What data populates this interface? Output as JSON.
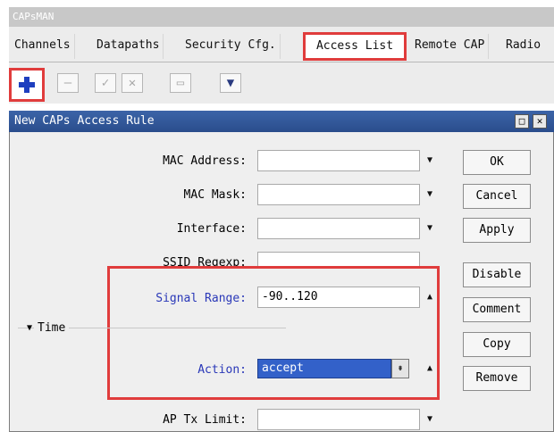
{
  "outer_window": {
    "title": "CAPsMAN"
  },
  "tabs": [
    "Channels",
    "Datapaths",
    "Security Cfg.",
    "Access List",
    "Remote CAP",
    "Radio"
  ],
  "toolbar": {
    "add": "+",
    "remove": "—",
    "enable": "✓",
    "disable": "✕",
    "comment": "▭",
    "filter": "▼"
  },
  "dialog": {
    "title": "New CAPs Access Rule",
    "window_buttons": [
      "□",
      "✕"
    ],
    "fields": {
      "mac_address": {
        "label": "MAC Address:",
        "value": ""
      },
      "mac_mask": {
        "label": "MAC Mask:",
        "value": ""
      },
      "interface": {
        "label": "Interface:",
        "value": ""
      },
      "ssid_regexp": {
        "label": "SSID Regexp:",
        "value": ""
      },
      "signal_range": {
        "label": "Signal Range:",
        "value": "-90..120"
      },
      "time": {
        "label": "Time"
      },
      "action": {
        "label": "Action:",
        "value": "accept"
      },
      "ap_tx_limit": {
        "label": "AP Tx Limit:",
        "value": ""
      }
    },
    "buttons": {
      "ok": "OK",
      "cancel": "Cancel",
      "apply": "Apply",
      "disable": "Disable",
      "comment": "Comment",
      "copy": "Copy",
      "remove": "Remove"
    }
  },
  "icons": {
    "down": "▼",
    "up": "▲",
    "select": "⇟",
    "time_toggle": "▼"
  },
  "colors": {
    "highlight_red": "#e03c3c",
    "title_blue": "#2a4d8c",
    "label_blue": "#2a38b8",
    "selection_blue": "#3361c9"
  }
}
